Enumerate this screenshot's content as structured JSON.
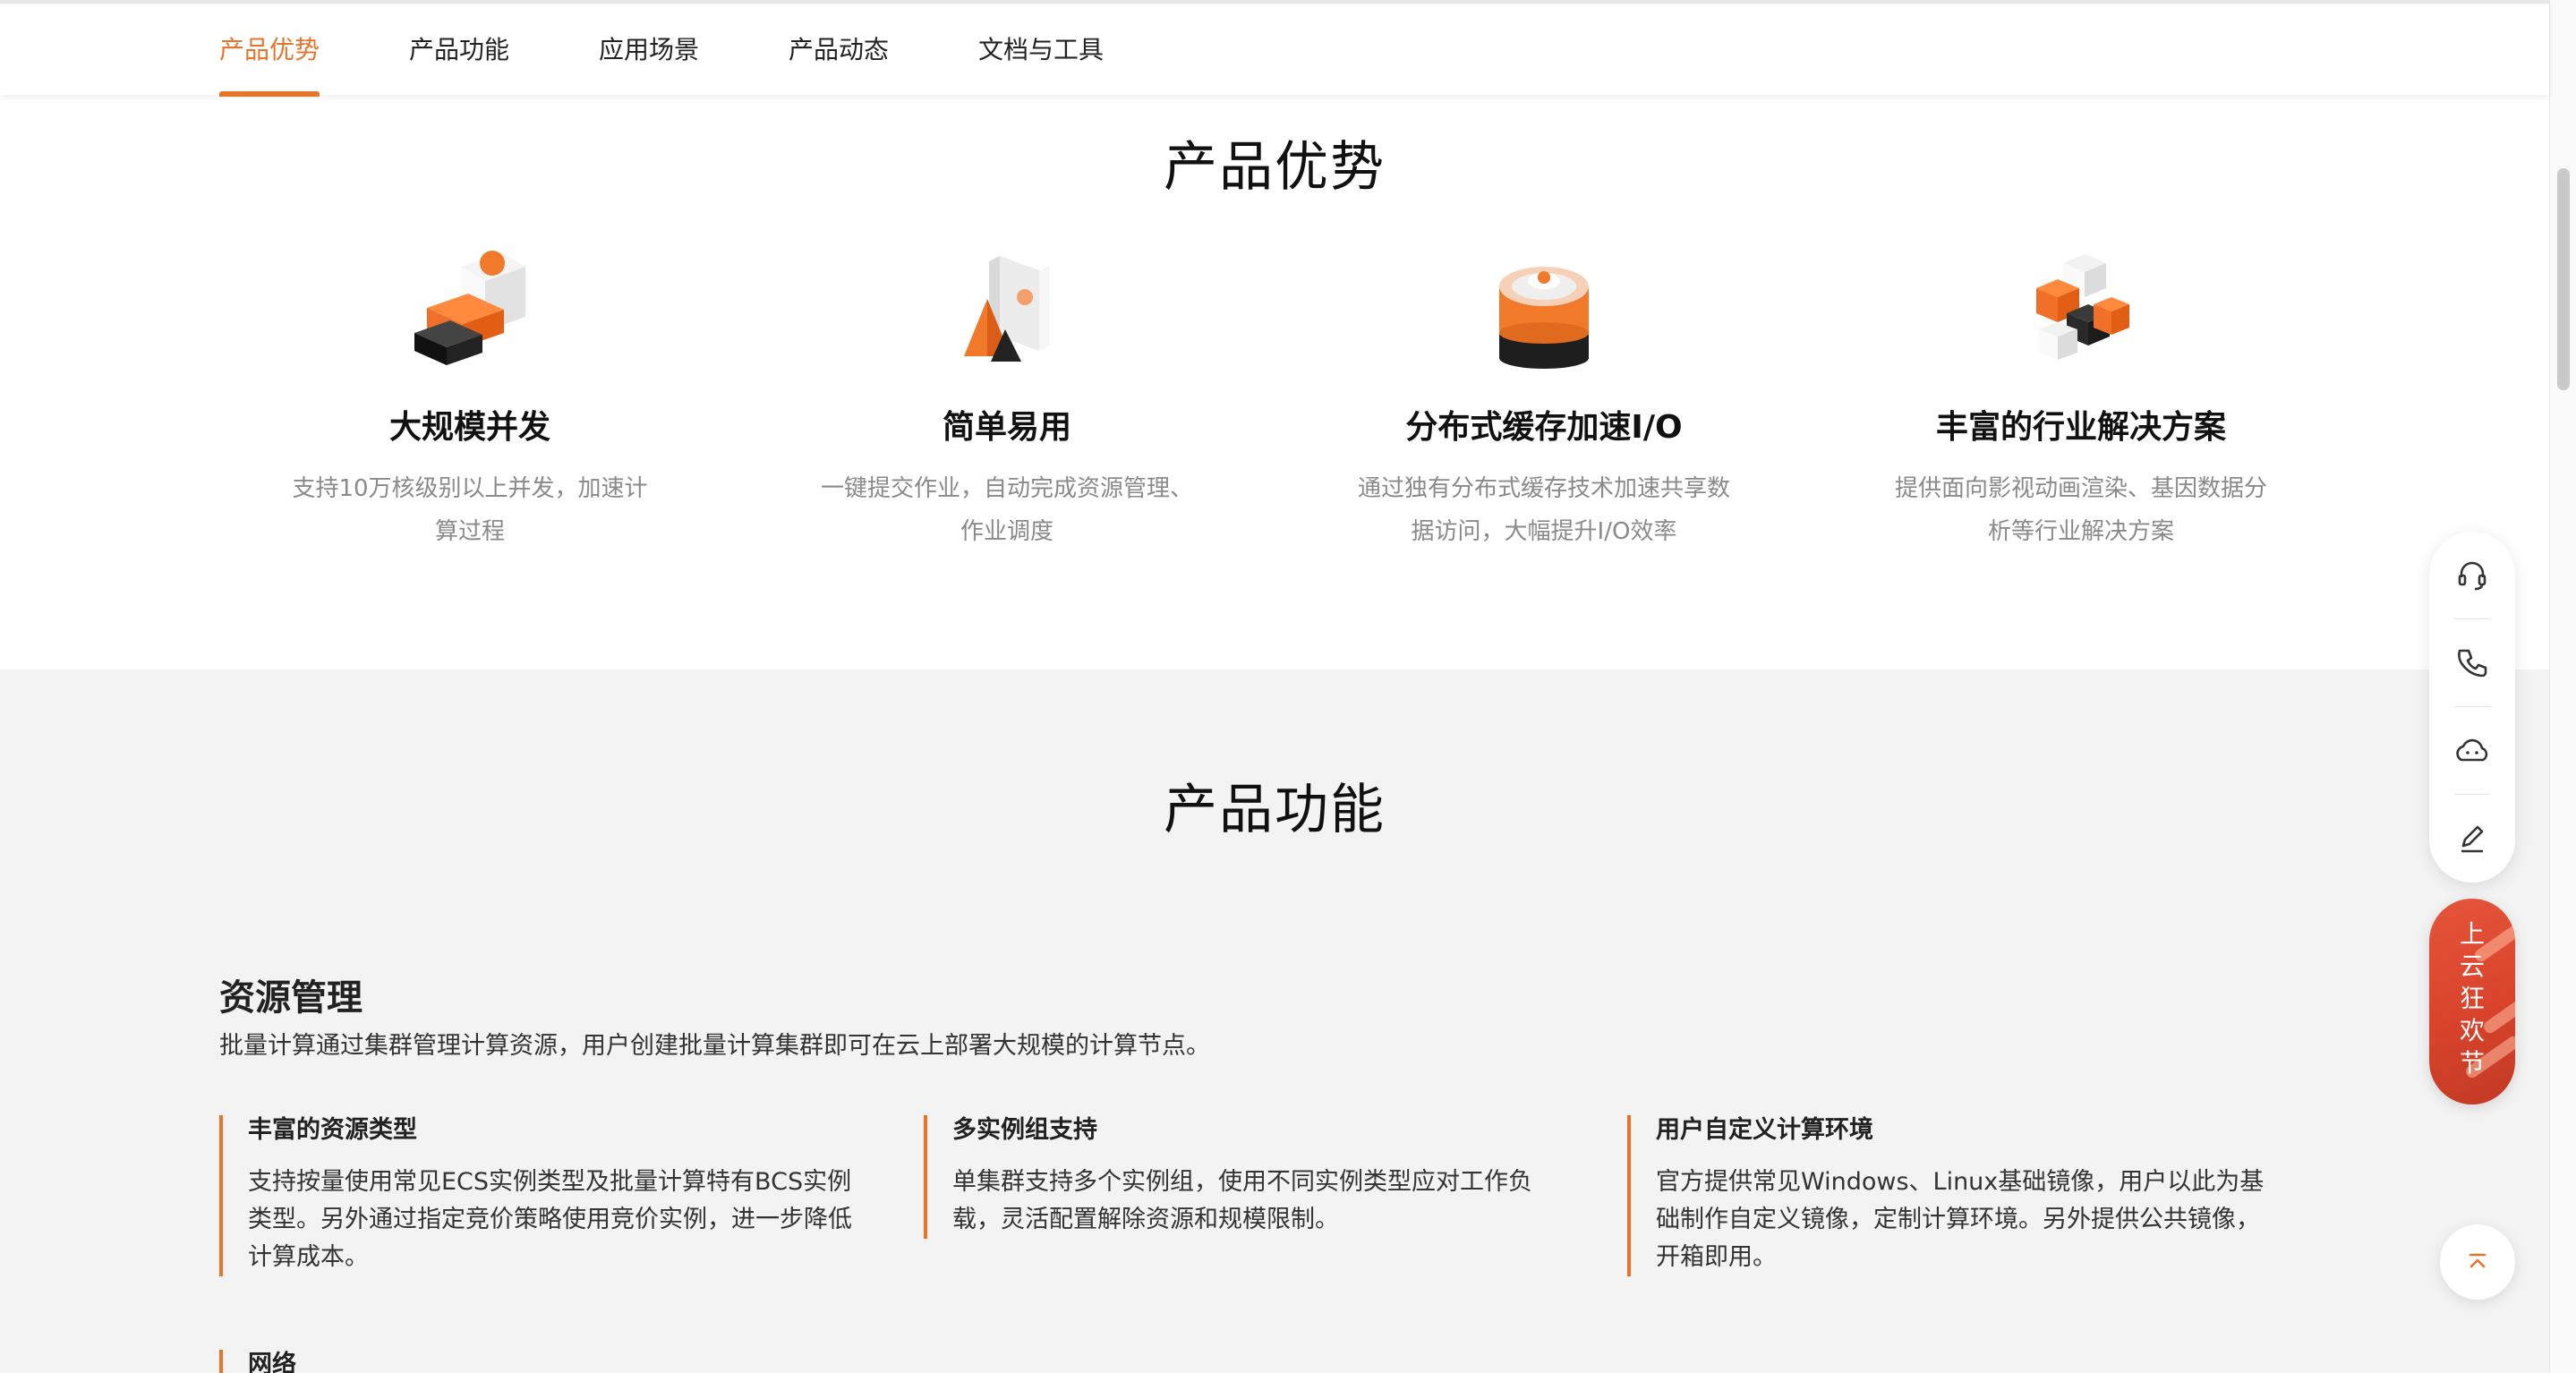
{
  "nav": {
    "tabs": [
      {
        "label": "产品优势",
        "active": true
      },
      {
        "label": "产品功能",
        "active": false
      },
      {
        "label": "应用场景",
        "active": false
      },
      {
        "label": "产品动态",
        "active": false
      },
      {
        "label": "文档与工具",
        "active": false
      }
    ]
  },
  "advantages": {
    "title": "产品优势",
    "items": [
      {
        "icon": "blocks-sphere-icon",
        "name": "大规模并发",
        "desc": "支持10万核级别以上并发，加速计算过程"
      },
      {
        "icon": "cone-panel-icon",
        "name": "简单易用",
        "desc": "一键提交作业，自动完成资源管理、作业调度"
      },
      {
        "icon": "cylinder-cache-icon",
        "name": "分布式缓存加速I/O",
        "desc": "通过独有分布式缓存技术加速共享数据访问，大幅提升I/O效率"
      },
      {
        "icon": "cubes-cluster-icon",
        "name": "丰富的行业解决方案",
        "desc": "提供面向影视动画渲染、基因数据分析等行业解决方案"
      }
    ]
  },
  "functions": {
    "title": "产品功能",
    "group": {
      "title": "资源管理",
      "desc": "批量计算通过集群管理计算资源，用户创建批量计算集群即可在云上部署大规模的计算节点。",
      "cards": [
        {
          "title": "丰富的资源类型",
          "text": "支持按量使用常见ECS实例类型及批量计算特有BCS实例类型。另外通过指定竞价策略使用竞价实例，进一步降低计算成本。"
        },
        {
          "title": "多实例组支持",
          "text": "单集群支持多个实例组，使用不同实例类型应对工作负载，灵活配置解除资源和规模限制。"
        },
        {
          "title": "用户自定义计算环境",
          "text": "官方提供常见Windows、Linux基础镜像，用户以此为基础制作自定义镜像，定制计算环境。另外提供公共镜像，开箱即用。"
        }
      ],
      "next_card_title": "网络"
    }
  },
  "side": {
    "buttons": [
      "headset-icon",
      "phone-icon",
      "cloud-bot-icon",
      "edit-icon"
    ],
    "promo_chars": [
      "上",
      "云",
      "狂",
      "欢",
      "节"
    ],
    "totop_icon": "back-to-top-icon"
  },
  "colors": {
    "accent": "#e8742c",
    "promo": "#d9432c",
    "text": "#222222",
    "muted": "#8a8a8a"
  }
}
